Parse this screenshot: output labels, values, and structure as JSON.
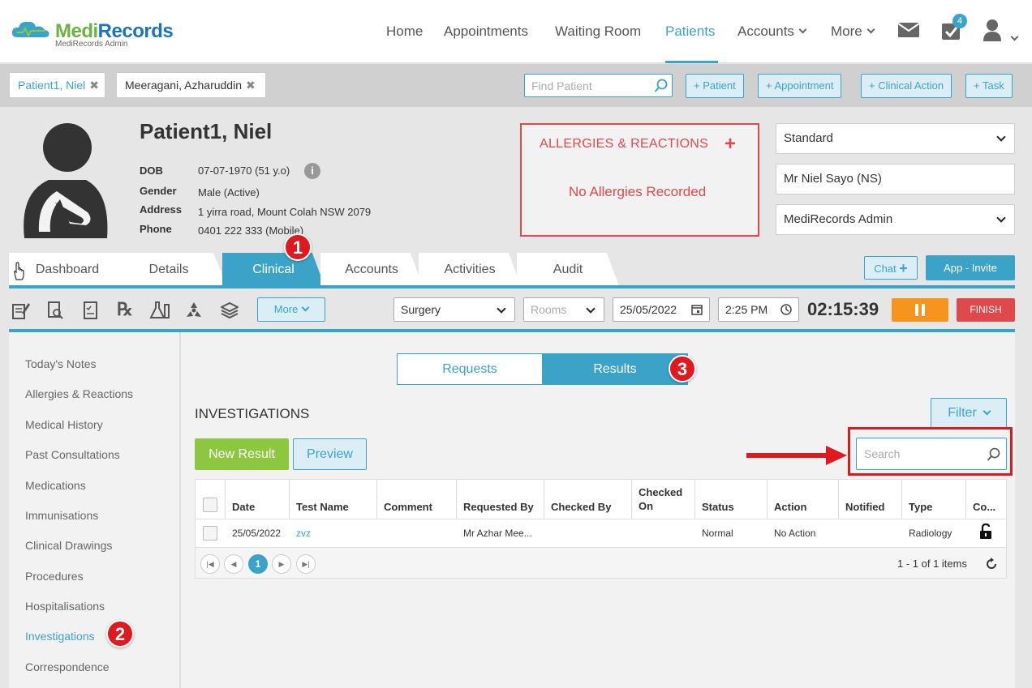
{
  "brand": {
    "name_part1": "Medi",
    "name_part2": "Records",
    "subtitle": "MediRecords Admin"
  },
  "nav": {
    "items": [
      {
        "label": "Home",
        "active": false
      },
      {
        "label": "Appointments",
        "active": false
      },
      {
        "label": "Waiting Room",
        "active": false
      },
      {
        "label": "Patients",
        "active": true
      },
      {
        "label": "Accounts",
        "active": false
      },
      {
        "label": "More",
        "active": false
      }
    ],
    "tasks_badge": "4"
  },
  "patient_tabs": [
    {
      "label": "Patient1, Niel"
    },
    {
      "label": "Meeragani, Azharuddin"
    }
  ],
  "find_patient": {
    "placeholder": "Find Patient",
    "value": ""
  },
  "quick_actions": [
    "+ Patient",
    "+ Appointment",
    "+ Clinical Action",
    "+ Task"
  ],
  "patient": {
    "name": "Patient1, Niel",
    "dob_label": "DOB",
    "dob": "07-07-1970 (51 y.o)",
    "gender_label": "Gender",
    "gender": "Male (Active)",
    "address_label": "Address",
    "address": "1 yirra road, Mount Colah NSW 2079",
    "phone_label": "Phone",
    "phone": "0401 222 333 (Mobile)"
  },
  "allergies": {
    "title": "ALLERGIES & REACTIONS",
    "empty": "No Allergies Recorded"
  },
  "selectors": {
    "billing": "Standard",
    "doctor": "Mr Niel Sayo (NS)",
    "account": "MediRecords Admin"
  },
  "tabs": [
    {
      "label": "Dashboard",
      "active": false
    },
    {
      "label": "Details",
      "active": false
    },
    {
      "label": "Clinical",
      "active": true
    },
    {
      "label": "Accounts",
      "active": false
    },
    {
      "label": "Activities",
      "active": false
    },
    {
      "label": "Audit",
      "active": false
    }
  ],
  "chat_label": "Chat",
  "invite_label": "App - Invite",
  "toolbar": {
    "more_label": "More",
    "location": "Surgery",
    "rooms_placeholder": "Rooms",
    "date": "25/05/2022",
    "time": "2:25 PM",
    "timer": "02:15:39",
    "finish_label": "FINISH"
  },
  "sidebar": [
    "Today's Notes",
    "Allergies & Reactions",
    "Medical History",
    "Past Consultations",
    "Medications",
    "Immunisations",
    "Clinical Drawings",
    "Procedures",
    "Hospitalisations",
    "Investigations",
    "Correspondence"
  ],
  "sidebar_active": "Investigations",
  "segments": {
    "requests": "Requests",
    "results": "Results"
  },
  "investigations": {
    "title": "INVESTIGATIONS",
    "filter_label": "Filter",
    "new_result_label": "New Result",
    "preview_label": "Preview",
    "search_placeholder": "Search",
    "columns": [
      "Date",
      "Test Name",
      "Comment",
      "Requested By",
      "Checked By",
      "Checked On",
      "Status",
      "Action",
      "Notified",
      "Type",
      "Co..."
    ],
    "rows": [
      {
        "date": "25/05/2022",
        "test_name": "zvz",
        "comment": "",
        "requested_by": "Mr Azhar Mee...",
        "checked_by": "",
        "checked_on": "",
        "status": "Normal",
        "action": "No Action",
        "notified": "",
        "type": "Radiology"
      }
    ],
    "current_page": "1",
    "pager_summary": "1 - 1 of 1 items"
  },
  "annotations": [
    "1",
    "2",
    "3"
  ],
  "colors": {
    "accent": "#3ba3c7",
    "alert": "#e0494b",
    "green": "#8dc63f",
    "orange": "#f7941d",
    "annotation": "#e0191e"
  }
}
